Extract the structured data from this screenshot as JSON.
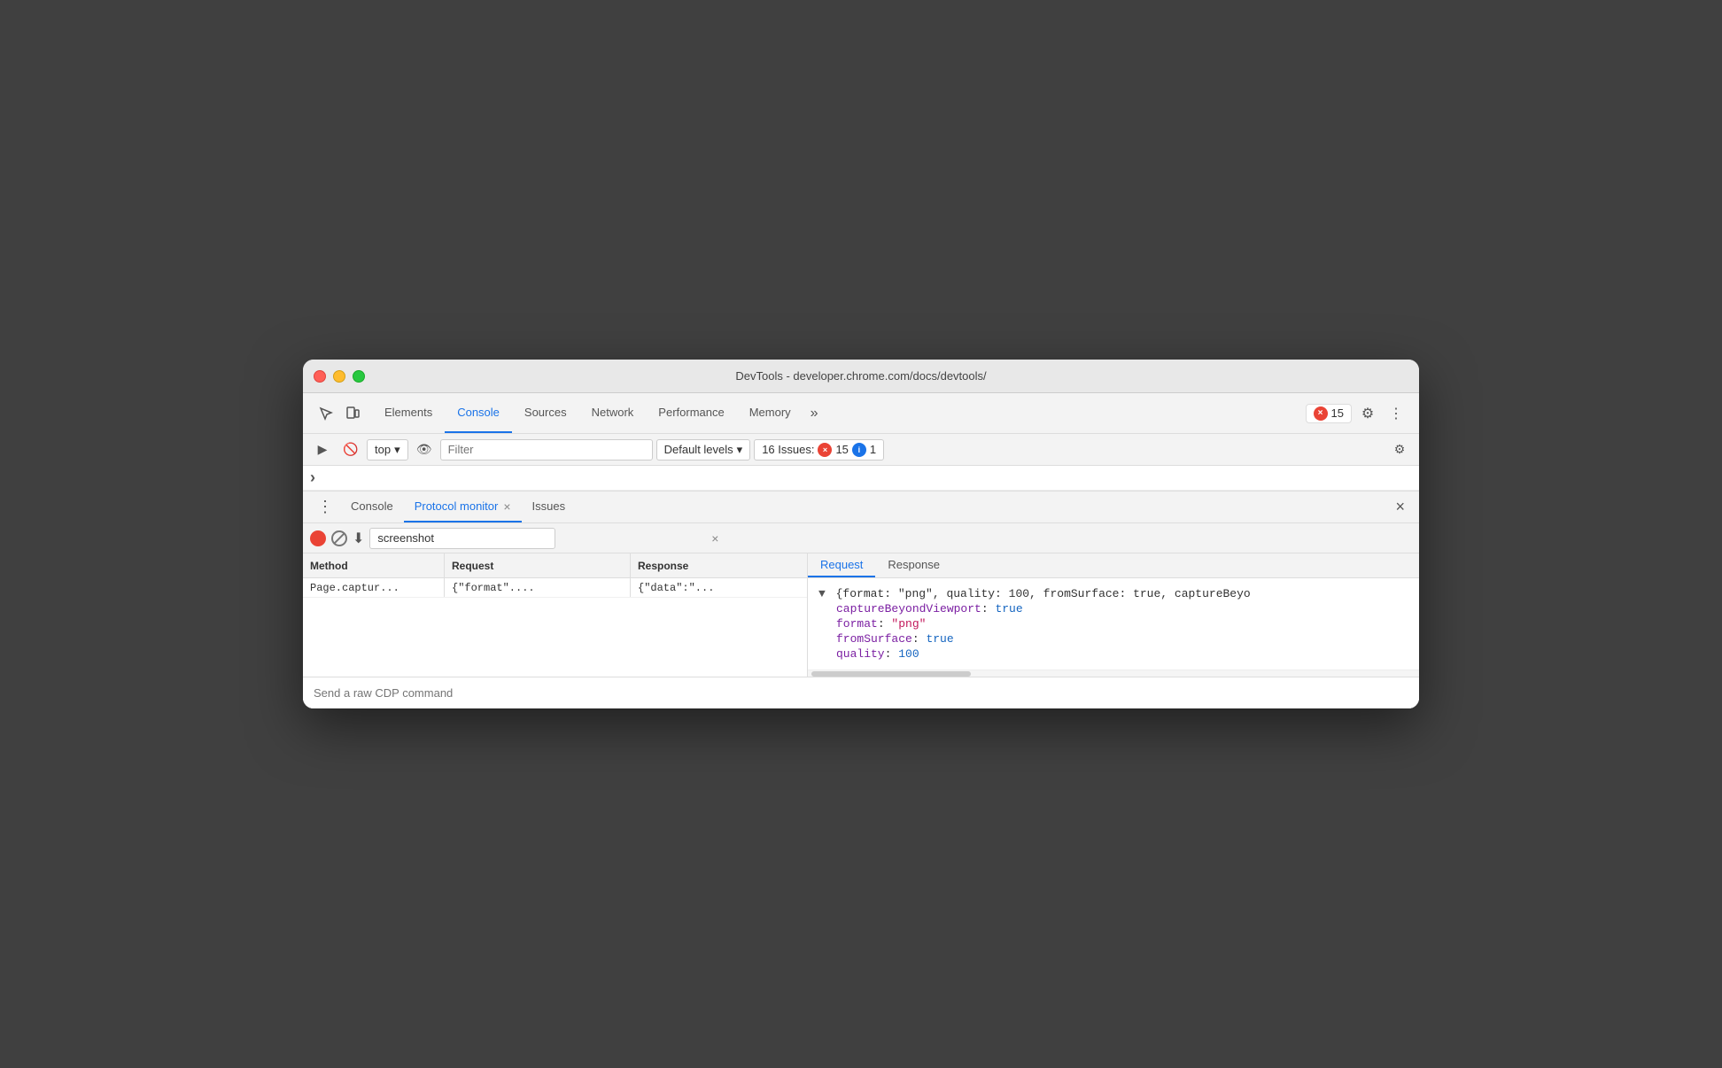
{
  "window": {
    "title": "DevTools - developer.chrome.com/docs/devtools/"
  },
  "tabbar": {
    "tabs": [
      {
        "id": "elements",
        "label": "Elements",
        "active": false
      },
      {
        "id": "console",
        "label": "Console",
        "active": true
      },
      {
        "id": "sources",
        "label": "Sources",
        "active": false
      },
      {
        "id": "network",
        "label": "Network",
        "active": false
      },
      {
        "id": "performance",
        "label": "Performance",
        "active": false
      },
      {
        "id": "memory",
        "label": "Memory",
        "active": false
      }
    ],
    "more_label": "»",
    "error_count": "15",
    "error_icon": "×",
    "settings_icon": "⚙",
    "more_icon": "⋮"
  },
  "console_toolbar": {
    "run_icon": "▶",
    "clear_icon": "🚫",
    "top_label": "top",
    "eye_icon": "👁",
    "filter_placeholder": "Filter",
    "default_levels_label": "Default levels",
    "dropdown_icon": "▾",
    "issues_label": "16 Issues:",
    "error_count": "15",
    "info_count": "1",
    "settings_icon": "⚙"
  },
  "expand_row": {
    "arrow": "›"
  },
  "drawer": {
    "dots": "⋮",
    "tabs": [
      {
        "id": "console",
        "label": "Console",
        "active": false,
        "closable": false
      },
      {
        "id": "protocol-monitor",
        "label": "Protocol monitor",
        "active": true,
        "closable": true
      },
      {
        "id": "issues",
        "label": "Issues",
        "active": false,
        "closable": false
      }
    ],
    "close_icon": "×"
  },
  "protocol_monitor": {
    "record_btn": "●",
    "clear_btn": "⊘",
    "download_btn": "⬇",
    "search_value": "screenshot",
    "search_clear": "×",
    "table": {
      "headers": [
        "Method",
        "Request",
        "Response"
      ],
      "rows": [
        {
          "method": "Page.captur...",
          "request": "{\"format\"....",
          "response": "{\"data\":\"..."
        }
      ]
    },
    "detail_tabs": [
      {
        "id": "request",
        "label": "Request",
        "active": true
      },
      {
        "id": "response",
        "label": "Response",
        "active": false
      }
    ],
    "detail_content": {
      "root_line": "{format: \"png\", quality: 100, fromSurface: true, captureBeyо",
      "lines": [
        {
          "key": "captureBeyondViewport",
          "value": "true",
          "type": "bool"
        },
        {
          "key": "format",
          "value": "\"png\"",
          "type": "str"
        },
        {
          "key": "fromSurface",
          "value": "true",
          "type": "bool"
        },
        {
          "key": "quality",
          "value": "100",
          "type": "num"
        }
      ]
    }
  },
  "send_command": {
    "placeholder": "Send a raw CDP command"
  }
}
